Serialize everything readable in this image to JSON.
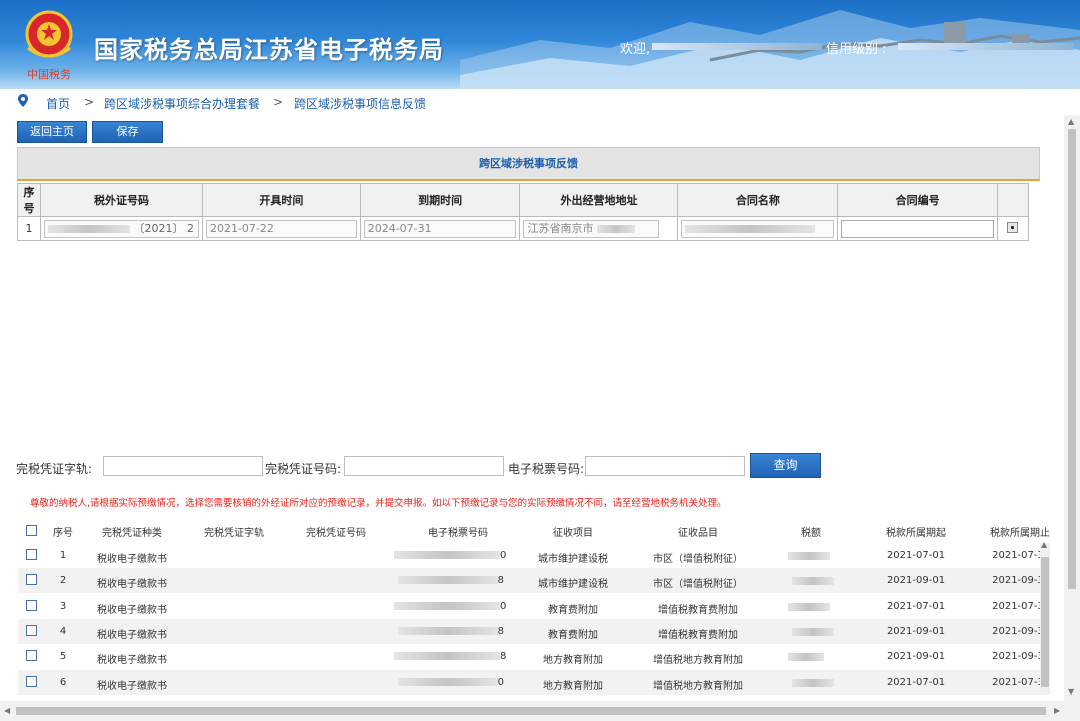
{
  "header": {
    "title": "国家税务总局江苏省电子税务局",
    "welcome_label": "欢迎,",
    "credit_label": "信用级别 :",
    "logo_caption": "中国税务"
  },
  "breadcrumb": {
    "home": "首页",
    "sep": ">",
    "level1": "跨区域涉税事项综合办理套餐",
    "level2": "跨区域涉税事项信息反馈"
  },
  "toolbar": {
    "back_label": "返回主页",
    "save_label": "保存"
  },
  "panel": {
    "title": "跨区域涉税事项反馈",
    "columns": [
      "序号",
      "税外证号码",
      "开具时间",
      "到期时间",
      "外出经营地地址",
      "合同名称",
      "合同编号"
    ],
    "row": {
      "index": "1",
      "cert_suffix": "〔2021〕 2",
      "issue_date": "2021-07-22",
      "expiry_date": "2024-07-31",
      "address": "江苏省南京市",
      "contract_no": ""
    }
  },
  "search": {
    "label1": "完税凭证字轨:",
    "label2": "完税凭证号码:",
    "label3": "电子税票号码:",
    "query_label": "查询",
    "value1": "",
    "value2": "",
    "value3": ""
  },
  "notice": "尊敬的纳税人,请根据实际预缴情况，选择您需要核销的外经证所对应的预缴记录，并提交申报。如以下预缴记录与您的实际预缴情况不同，请至经营地税务机关处理。",
  "grid": {
    "columns": [
      "序号",
      "完税凭证种类",
      "完税凭证字轨",
      "完税凭证号码",
      "电子税票号码",
      "征收项目",
      "征收品目",
      "税额",
      "税款所属期起",
      "税款所属期止"
    ],
    "rows": [
      {
        "no": "1",
        "type": "税收电子缴款书",
        "ticket_tail": "0",
        "item": "城市维护建设税",
        "sub": "市区（增值税附征）",
        "start": "2021-07-01",
        "end": "2021-07-3"
      },
      {
        "no": "2",
        "type": "税收电子缴款书",
        "ticket_tail": "8",
        "item": "城市维护建设税",
        "sub": "市区（增值税附征）",
        "start": "2021-09-01",
        "end": "2021-09-3"
      },
      {
        "no": "3",
        "type": "税收电子缴款书",
        "ticket_tail": "0",
        "item": "教育费附加",
        "sub": "增值税教育费附加",
        "start": "2021-07-01",
        "end": "2021-07-3"
      },
      {
        "no": "4",
        "type": "税收电子缴款书",
        "ticket_tail": "8",
        "item": "教育费附加",
        "sub": "增值税教育费附加",
        "start": "2021-09-01",
        "end": "2021-09-3"
      },
      {
        "no": "5",
        "type": "税收电子缴款书",
        "ticket_tail": "8",
        "item": "地方教育附加",
        "sub": "增值税地方教育附加",
        "start": "2021-09-01",
        "end": "2021-09-3"
      },
      {
        "no": "6",
        "type": "税收电子缴款书",
        "ticket_tail": "0",
        "item": "地方教育附加",
        "sub": "增值税地方教育附加",
        "start": "2021-07-01",
        "end": "2021-07-3"
      }
    ]
  },
  "colors": {
    "brand_blue": "#1f63b4",
    "link_blue": "#1b5fad",
    "warning_red": "#e8231c",
    "accent_orange": "#e5a23c"
  }
}
